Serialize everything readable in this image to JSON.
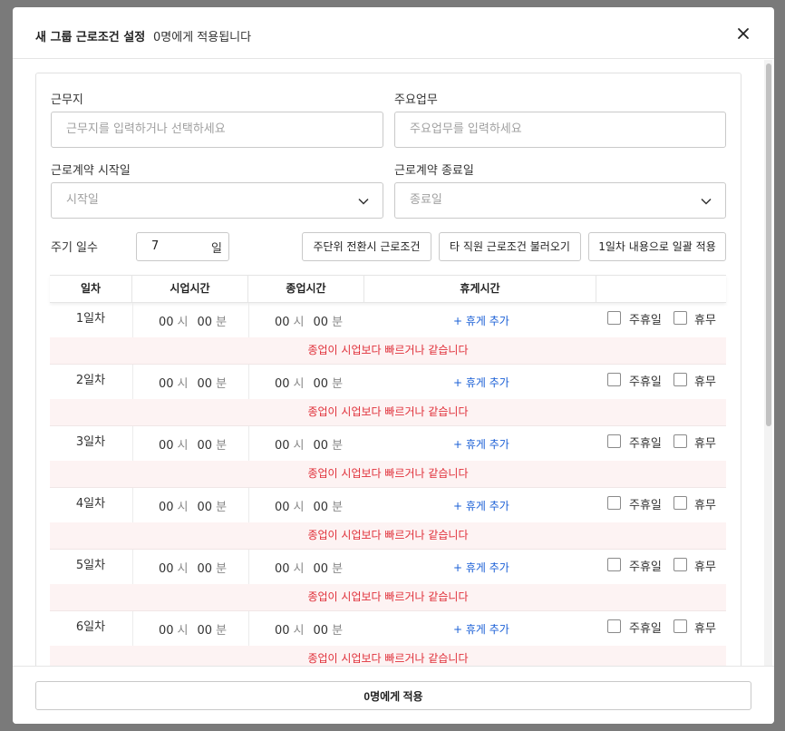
{
  "header": {
    "title": "새 그룹 근로조건 설정",
    "subtitle": "0명에게 적용됩니다"
  },
  "form": {
    "workplace_label": "근무지",
    "workplace_placeholder": "근무지를 입력하거나 선택하세요",
    "duty_label": "주요업무",
    "duty_placeholder": "주요업무를 입력하세요",
    "start_label": "근로계약 시작일",
    "start_placeholder": "시작일",
    "end_label": "근로계약 종료일",
    "end_placeholder": "종료일",
    "cycle_label": "주기 일수",
    "cycle_value": "7",
    "cycle_unit": "일"
  },
  "actions": {
    "weekly_convert": "주단위 전환시 근로조건",
    "load_other": "타 직원 근로조건 불러오기",
    "apply_day1": "1일차 내용으로 일괄 적용"
  },
  "table": {
    "headers": [
      "일차",
      "시업시간",
      "종업시간",
      "휴게시간",
      ""
    ],
    "hour_unit": "시",
    "minute_unit": "분",
    "add_break": "+ 휴게 추가",
    "weekly_holiday": "주휴일",
    "day_off": "휴무",
    "error": "종업이 시업보다 빠르거나 같습니다",
    "rows": [
      {
        "day": "1일차",
        "start_h": "00",
        "start_m": "00",
        "end_h": "00",
        "end_m": "00"
      },
      {
        "day": "2일차",
        "start_h": "00",
        "start_m": "00",
        "end_h": "00",
        "end_m": "00"
      },
      {
        "day": "3일차",
        "start_h": "00",
        "start_m": "00",
        "end_h": "00",
        "end_m": "00"
      },
      {
        "day": "4일차",
        "start_h": "00",
        "start_m": "00",
        "end_h": "00",
        "end_m": "00"
      },
      {
        "day": "5일차",
        "start_h": "00",
        "start_m": "00",
        "end_h": "00",
        "end_m": "00"
      },
      {
        "day": "6일차",
        "start_h": "00",
        "start_m": "00",
        "end_h": "00",
        "end_m": "00"
      }
    ]
  },
  "footer": {
    "apply_label": "0명에게 적용"
  },
  "colors": {
    "link": "#1a5fd6",
    "error": "#e0303a",
    "error_bg": "#fdf3f3"
  }
}
